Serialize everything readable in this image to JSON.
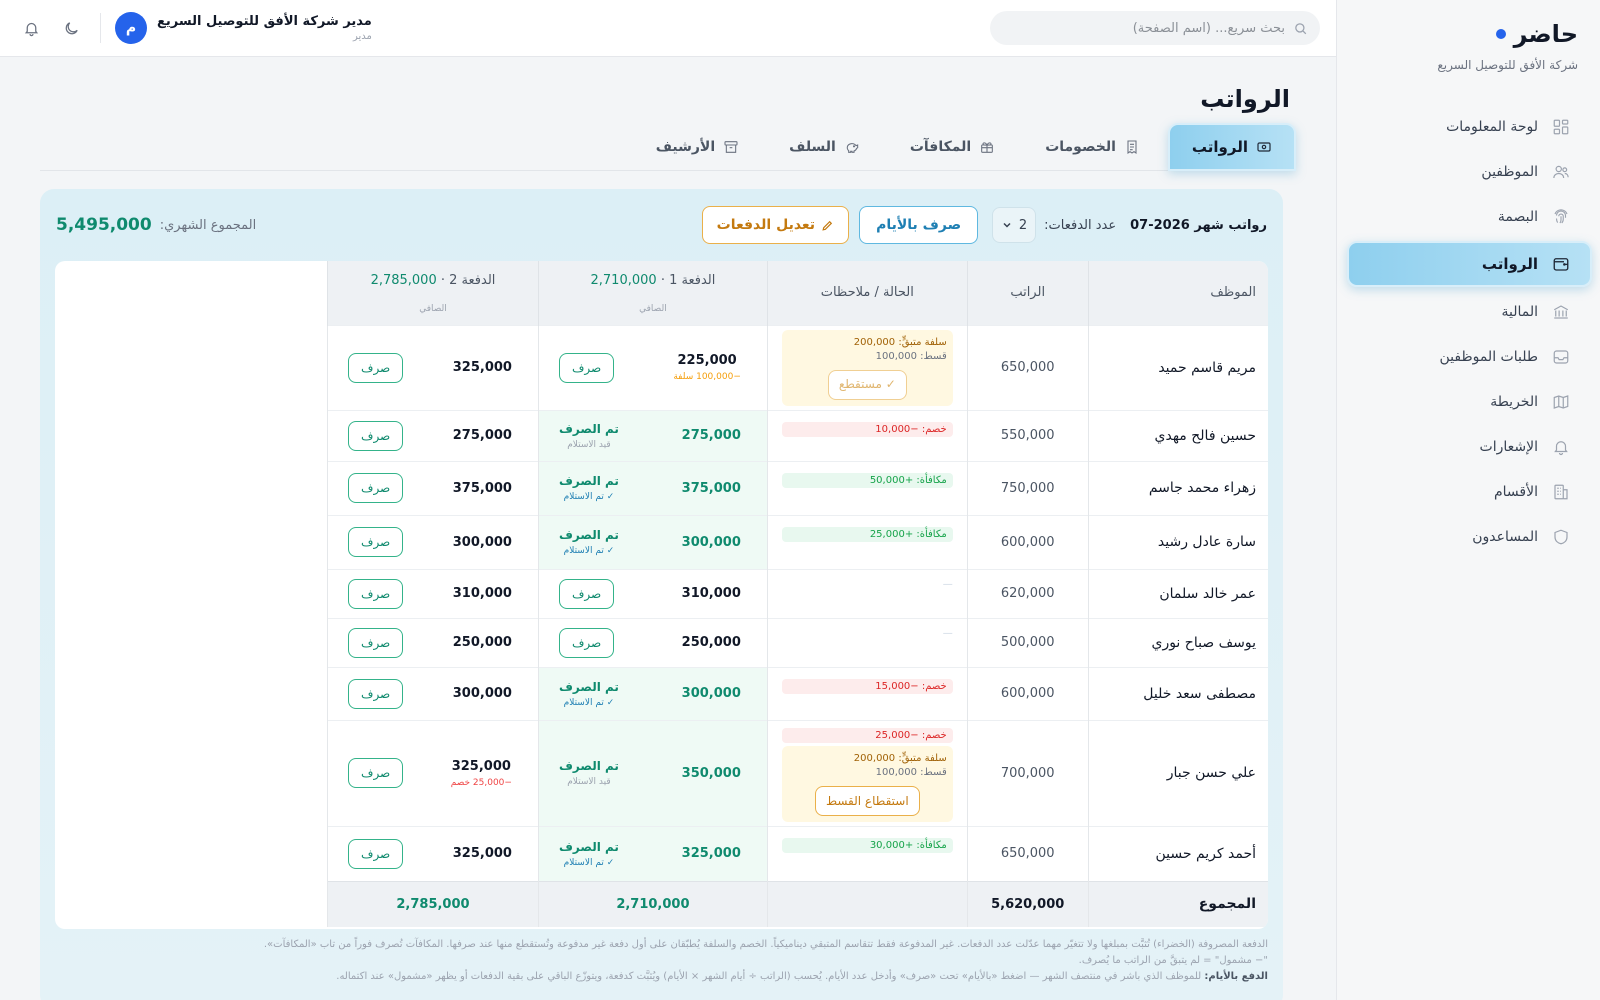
{
  "brand": {
    "title": "حاضر",
    "subtitle": "شركة الأفق للتوصيل السريع"
  },
  "sidebar": {
    "items": [
      {
        "label": "لوحة المعلومات",
        "icon": "dashboard-icon"
      },
      {
        "label": "الموظفين",
        "icon": "users-icon"
      },
      {
        "label": "البصمة",
        "icon": "fingerprint-icon"
      },
      {
        "label": "الرواتب",
        "icon": "wallet-icon",
        "active": true
      },
      {
        "label": "المالية",
        "icon": "bank-icon"
      },
      {
        "label": "طلبات الموظفين",
        "icon": "inbox-icon"
      },
      {
        "label": "الخريطة",
        "icon": "map-icon"
      },
      {
        "label": "الإشعارات",
        "icon": "bell-icon"
      },
      {
        "label": "الأقسام",
        "icon": "building-icon"
      },
      {
        "label": "المساعدون",
        "icon": "shield-icon"
      }
    ]
  },
  "topbar": {
    "search_placeholder": "بحث سريع... (اسم الصفحة)",
    "user_name": "مدير شركة الأفق للتوصيل السريع",
    "user_role": "مدير",
    "avatar_letter": "م"
  },
  "page": {
    "title": "الرواتب",
    "tabs": [
      {
        "label": "الرواتب",
        "icon": "cash-icon",
        "active": true
      },
      {
        "label": "الخصومات",
        "icon": "receipt-icon"
      },
      {
        "label": "المكافآت",
        "icon": "gift-icon"
      },
      {
        "label": "السلف",
        "icon": "piggy-bank-icon"
      },
      {
        "label": "الأرشيف",
        "icon": "archive-icon"
      }
    ]
  },
  "panel": {
    "title": "رواتب شهر 2026-07",
    "payments_label": "عدد الدفعات:",
    "payments_count": "2",
    "pay_by_days": "صرف بالأيام",
    "edit_payments": "تعديل الدفعات",
    "monthly_total_label": "المجموع الشهري:",
    "monthly_total": "5,495,000"
  },
  "table": {
    "headers": {
      "employee": "الموظف",
      "salary": "الراتب",
      "status": "الحالة / ملاحظات",
      "pay1_label": "الدفعة 1 ·",
      "pay1_total": "2,710,000",
      "pay2_label": "الدفعة 2 ·",
      "pay2_total": "2,785,000",
      "net": "الصافي"
    },
    "pay_btn": "صرف",
    "paid_label": "تم الصرف",
    "pending_receipt": "قيد الاستلام",
    "received": "✓ تم الاستلام",
    "rows": [
      {
        "name": "مريم قاسم حميد",
        "salary": "650,000",
        "advance": "سلفة متبقٍّ: 200,000",
        "installment": "قسط: 100,000",
        "adv_btn": "✓ مستقطع",
        "p1": "225,000",
        "p1_sub": "−100,000 سلفة",
        "p2": "325,000"
      },
      {
        "name": "حسين فالح مهدي",
        "salary": "550,000",
        "deduction": "خصم: −10,000",
        "p1": "275,000",
        "p1_status": "pending",
        "p2": "275,000"
      },
      {
        "name": "زهراء محمد جاسم",
        "salary": "750,000",
        "bonus": "مكافأة: +50,000",
        "p1": "375,000",
        "p1_status": "received",
        "p2": "375,000"
      },
      {
        "name": "سارة عادل رشيد",
        "salary": "600,000",
        "bonus": "مكافأة: +25,000",
        "p1": "300,000",
        "p1_status": "received",
        "p2": "300,000"
      },
      {
        "name": "عمر خالد سلمان",
        "salary": "620,000",
        "dash": "—",
        "p1": "310,000",
        "p2": "310,000"
      },
      {
        "name": "يوسف صباح نوري",
        "salary": "500,000",
        "dash": "—",
        "p1": "250,000",
        "p2": "250,000"
      },
      {
        "name": "مصطفى سعد خليل",
        "salary": "600,000",
        "deduction": "خصم: −15,000",
        "p1": "300,000",
        "p1_status": "received",
        "p2": "300,000"
      },
      {
        "name": "علي حسن جبار",
        "salary": "700,000",
        "deduction": "خصم: −25,000",
        "advance": "سلفة متبقٍّ: 200,000",
        "installment": "قسط: 100,000",
        "adv_btn": "استقطاع القسط",
        "p1": "350,000",
        "p1_status": "pending",
        "p2": "325,000",
        "p2_sub": "−25,000 خصم"
      },
      {
        "name": "أحمد كريم حسين",
        "salary": "650,000",
        "bonus": "مكافأة: +30,000",
        "p1": "325,000",
        "p1_status": "received",
        "p2": "325,000"
      }
    ],
    "total": {
      "label": "المجموع",
      "salary": "5,620,000",
      "p1": "2,710,000",
      "p2": "2,785,000"
    }
  },
  "footer_notes": {
    "line1": "الدفعة المصروفة (الخضراء) تُثبَّت بمبلغها ولا تتغيّر مهما عدّلت عدد الدفعات. غير المدفوعة فقط تتقاسم المتبقي ديناميكياً. الخصم والسلفة يُطبّقان على أول دفعة غير مدفوعة وتُستقطع منها عند صرفها. المكافآت تُصرف فوراً من تاب «المكافآت».",
    "line2": "\"− مشمول\" = لم يتبقَّ من الراتب ما يُصرف.",
    "line3_bold": "الدفع بالأيام:",
    "line3": "للموظف الذي باشر في منتصف الشهر — اضغط «بالأيام» تحت «صرف» وأدخل عدد الأيام. يُحسب (الراتب ÷ أيام الشهر × الأيام) ويُثبَّت كدفعة، ويتوزّع الباقي على بقية الدفعات أو يظهر «مشمول» عند اكتماله."
  }
}
